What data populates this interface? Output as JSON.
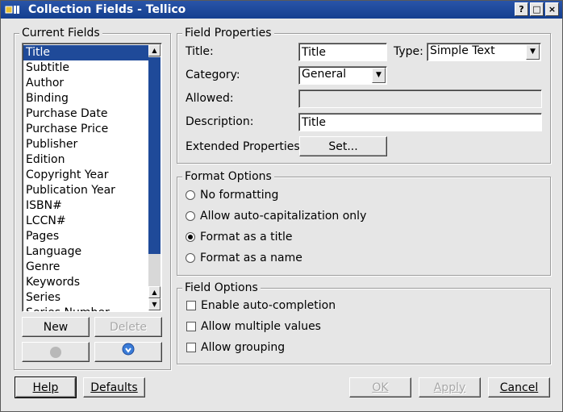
{
  "window": {
    "title": "Collection Fields - Tellico",
    "buttons": [
      "?",
      "□",
      "×"
    ]
  },
  "current_fields": {
    "title": "Current Fields",
    "items": [
      "Title",
      "Subtitle",
      "Author",
      "Binding",
      "Purchase Date",
      "Purchase Price",
      "Publisher",
      "Edition",
      "Copyright Year",
      "Publication Year",
      "ISBN#",
      "LCCN#",
      "Pages",
      "Language",
      "Genre",
      "Keywords",
      "Series",
      "Series Number"
    ],
    "selected": "Title",
    "new_label": "New",
    "delete_label": "Delete"
  },
  "field_properties": {
    "title": "Field Properties",
    "title_label": "Title:",
    "title_value": "Title",
    "type_label": "Type:",
    "type_value": "Simple Text",
    "category_label": "Category:",
    "category_value": "General",
    "allowed_label": "Allowed:",
    "allowed_value": "",
    "description_label": "Description:",
    "description_value": "Title",
    "extended_label": "Extended Properties:",
    "set_label": "Set..."
  },
  "format_options": {
    "title": "Format Options",
    "options": [
      "No formatting",
      "Allow auto-capitalization only",
      "Format as a title",
      "Format as a name"
    ],
    "selected": "Format as a title"
  },
  "field_options": {
    "title": "Field Options",
    "options": [
      "Enable auto-completion",
      "Allow multiple values",
      "Allow grouping"
    ],
    "checked": []
  },
  "footer": {
    "help_label": "Help",
    "defaults_label": "Defaults",
    "ok_label": "OK",
    "apply_label": "Apply",
    "cancel_label": "Cancel"
  },
  "colors": {
    "titlebar": "#1f4a99",
    "selection": "#1f4a99",
    "background": "#e6e6e6"
  }
}
